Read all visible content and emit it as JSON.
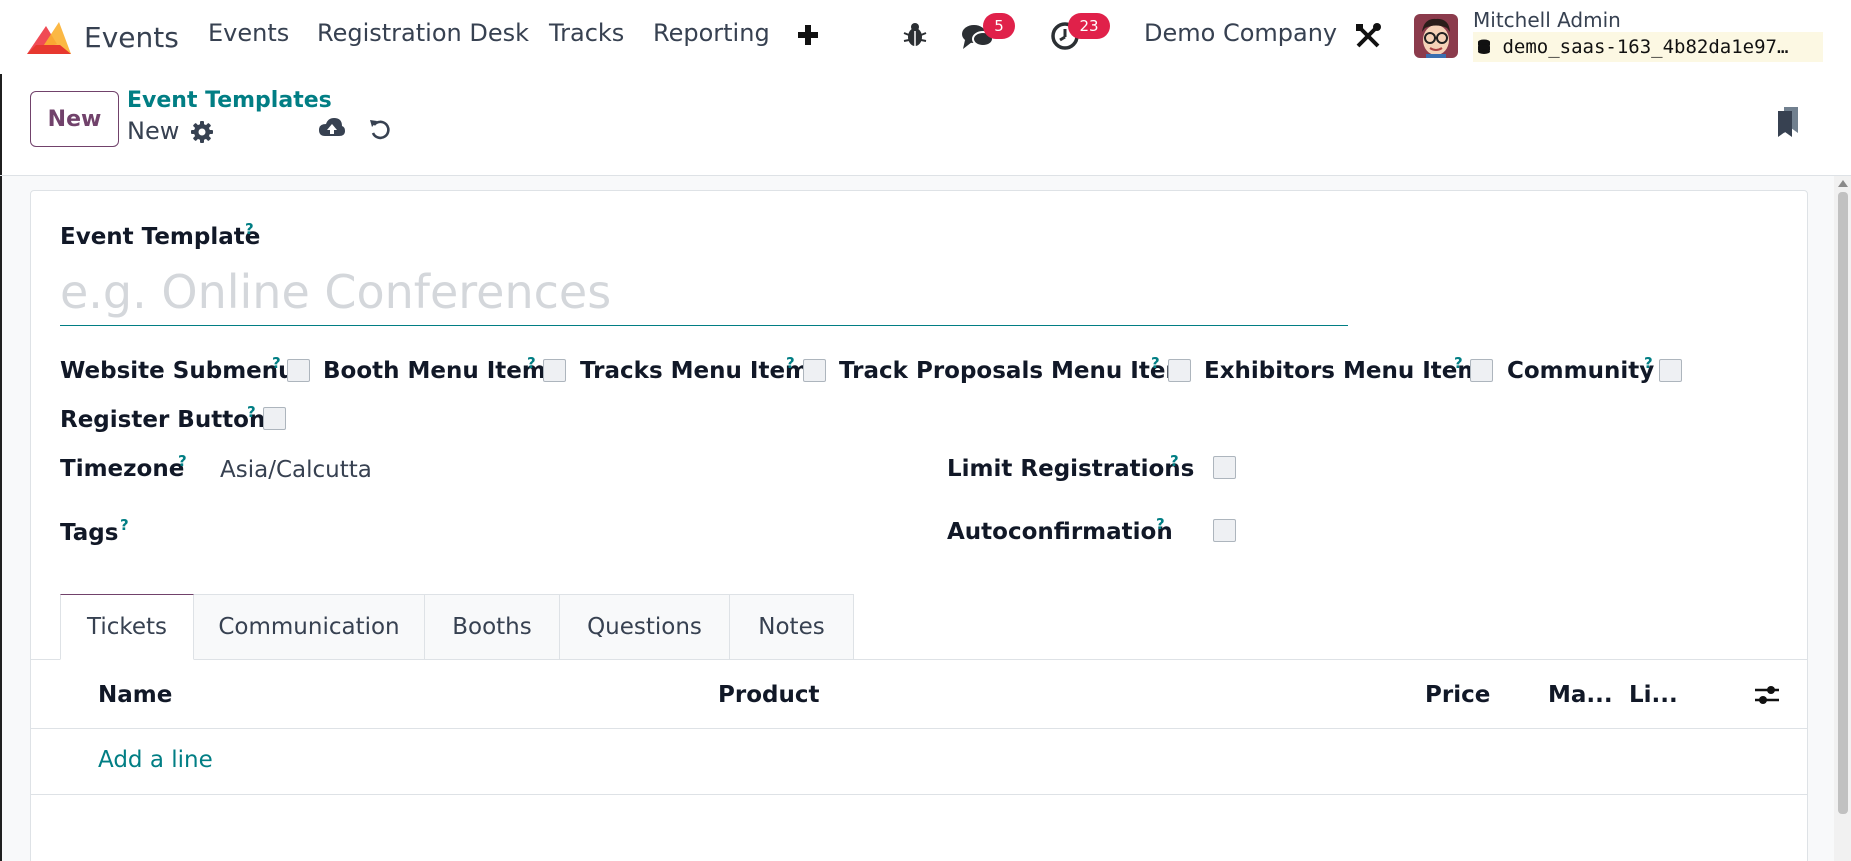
{
  "navbar": {
    "app_name": "Events",
    "menu": [
      "Events",
      "Registration Desk",
      "Tracks",
      "Reporting"
    ],
    "add_icon": "plus-icon",
    "debug_icon": "bug-icon",
    "messages_icon": "chat-icon",
    "messages_count": "5",
    "activities_icon": "clock-icon",
    "activities_count": "23",
    "company": "Demo Company",
    "settings_icon": "tools-icon",
    "user_name": "Mitchell Admin",
    "database": "demo_saas-163_4b82da1e97…"
  },
  "control_panel": {
    "new_button": "New",
    "breadcrumb_parent": "Event Templates",
    "breadcrumb_current": "New",
    "gear_icon": "gear-icon",
    "save_icon": "cloud-upload-icon",
    "discard_icon": "undo-icon",
    "bookmark_icon": "bookmark-icon"
  },
  "form": {
    "name_label": "Event Template",
    "name_placeholder": "e.g. Online Conferences",
    "name_value": "",
    "help_mark": "?",
    "checkboxes": [
      {
        "label": "Website Submenu",
        "checked": false
      },
      {
        "label": "Booth Menu Item",
        "checked": false
      },
      {
        "label": "Tracks Menu Item",
        "checked": false
      },
      {
        "label": "Track Proposals Menu Item",
        "checked": false
      },
      {
        "label": "Exhibitors Menu Item",
        "checked": false
      },
      {
        "label": "Community",
        "checked": false
      },
      {
        "label": "Register Button",
        "checked": false
      }
    ],
    "timezone_label": "Timezone",
    "timezone_value": "Asia/Calcutta",
    "tags_label": "Tags",
    "tags_value": "",
    "limit_label": "Limit Registrations",
    "limit_checked": false,
    "autoconfirm_label": "Autoconfirmation",
    "autoconfirm_checked": false
  },
  "tabs": [
    {
      "label": "Tickets",
      "active": true
    },
    {
      "label": "Communication",
      "active": false
    },
    {
      "label": "Booths",
      "active": false
    },
    {
      "label": "Questions",
      "active": false
    },
    {
      "label": "Notes",
      "active": false
    }
  ],
  "tickets_list": {
    "columns": [
      "Name",
      "Product",
      "Price",
      "Ma...",
      "Li..."
    ],
    "rows": [],
    "add_line": "Add a line",
    "optional_columns_icon": "sliders-icon"
  },
  "colors": {
    "brand_primary": "#71426b",
    "accent_teal": "#017e84",
    "badge_red": "#e0214a"
  }
}
